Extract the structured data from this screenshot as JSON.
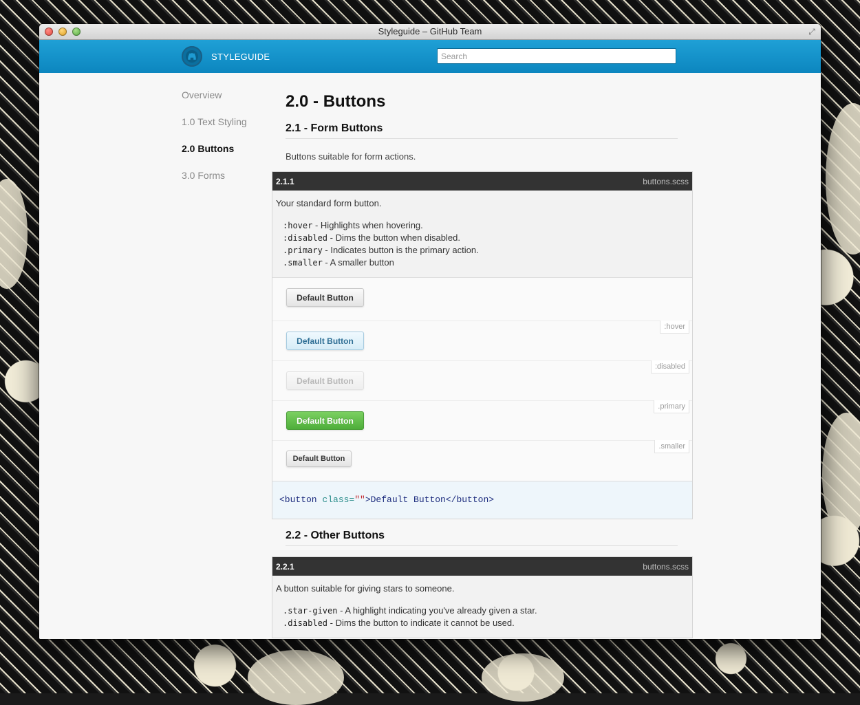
{
  "window": {
    "title": "Styleguide – GitHub Team"
  },
  "header": {
    "brand": "STYLEGUIDE",
    "search_placeholder": "Search"
  },
  "sidebar": {
    "items": [
      {
        "label": "Overview",
        "active": false
      },
      {
        "label": "1.0 Text Styling",
        "active": false
      },
      {
        "label": "2.0 Buttons",
        "active": true
      },
      {
        "label": "3.0 Forms",
        "active": false
      }
    ]
  },
  "main": {
    "title": "2.0 - Buttons",
    "section1": {
      "title": "2.1 - Form Buttons",
      "lead": "Buttons suitable for form actions.",
      "box": {
        "ref": "2.1.1",
        "file": "buttons.scss",
        "description": "Your standard form button.",
        "modifiers": [
          {
            "name": ":hover",
            "text": " - Highlights when hovering."
          },
          {
            "name": ":disabled",
            "text": " - Dims the button when disabled."
          },
          {
            "name": ".primary",
            "text": " - Indicates button is the primary action."
          },
          {
            "name": ".smaller",
            "text": " - A smaller button"
          }
        ],
        "examples": [
          {
            "tag": "",
            "button": "Default Button"
          },
          {
            "tag": ":hover",
            "button": "Default Button"
          },
          {
            "tag": ":disabled",
            "button": "Default Button"
          },
          {
            "tag": ".primary",
            "button": "Default Button"
          },
          {
            "tag": ".smaller",
            "button": "Default Button"
          }
        ],
        "code": {
          "open": "<button",
          "attr": " class=",
          "value": "\"\"",
          "close": ">Default Button</button>"
        }
      }
    },
    "section2": {
      "title": "2.2 - Other Buttons",
      "box": {
        "ref": "2.2.1",
        "file": "buttons.scss",
        "description": "A button suitable for giving stars to someone.",
        "modifiers": [
          {
            "name": ".star-given",
            "text": " - A highlight indicating you've already given a star."
          },
          {
            "name": ".disabled",
            "text": " - Dims the button to indicate it cannot be used."
          }
        ]
      }
    }
  }
}
